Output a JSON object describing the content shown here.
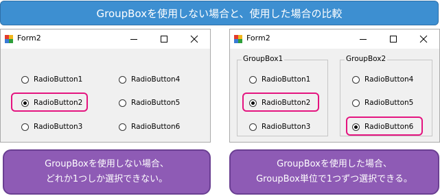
{
  "banner": {
    "text": "GroupBoxを使用しない場合と、使用した場合の比較"
  },
  "colors": {
    "banner": "#3d8fd1",
    "highlight": "#e4137f",
    "callout": "#8e5bb5"
  },
  "left_window": {
    "title": "Form2",
    "radios": [
      {
        "label": "RadioButton1",
        "checked": false
      },
      {
        "label": "RadioButton2",
        "checked": true
      },
      {
        "label": "RadioButton3",
        "checked": false
      },
      {
        "label": "RadioButton4",
        "checked": false
      },
      {
        "label": "RadioButton5",
        "checked": false
      },
      {
        "label": "RadioButton6",
        "checked": false
      }
    ]
  },
  "right_window": {
    "title": "Form2",
    "group1": {
      "label": "GroupBox1",
      "radios": [
        {
          "label": "RadioButton1",
          "checked": false
        },
        {
          "label": "RadioButton2",
          "checked": true
        },
        {
          "label": "RadioButton3",
          "checked": false
        }
      ]
    },
    "group2": {
      "label": "GroupBox2",
      "radios": [
        {
          "label": "RadioButton4",
          "checked": false
        },
        {
          "label": "RadioButton5",
          "checked": false
        },
        {
          "label": "RadioButton6",
          "checked": true
        }
      ]
    }
  },
  "callouts": {
    "left": {
      "line1": "GroupBoxを使用しない場合、",
      "line2": "どれか1つしか選択できない。"
    },
    "right": {
      "line1": "GroupBoxを使用した場合、",
      "line2": "GroupBox単位で1つずつ選択できる。"
    }
  },
  "icons": [
    "form-app-icon",
    "minimize-icon",
    "maximize-icon",
    "close-icon"
  ]
}
